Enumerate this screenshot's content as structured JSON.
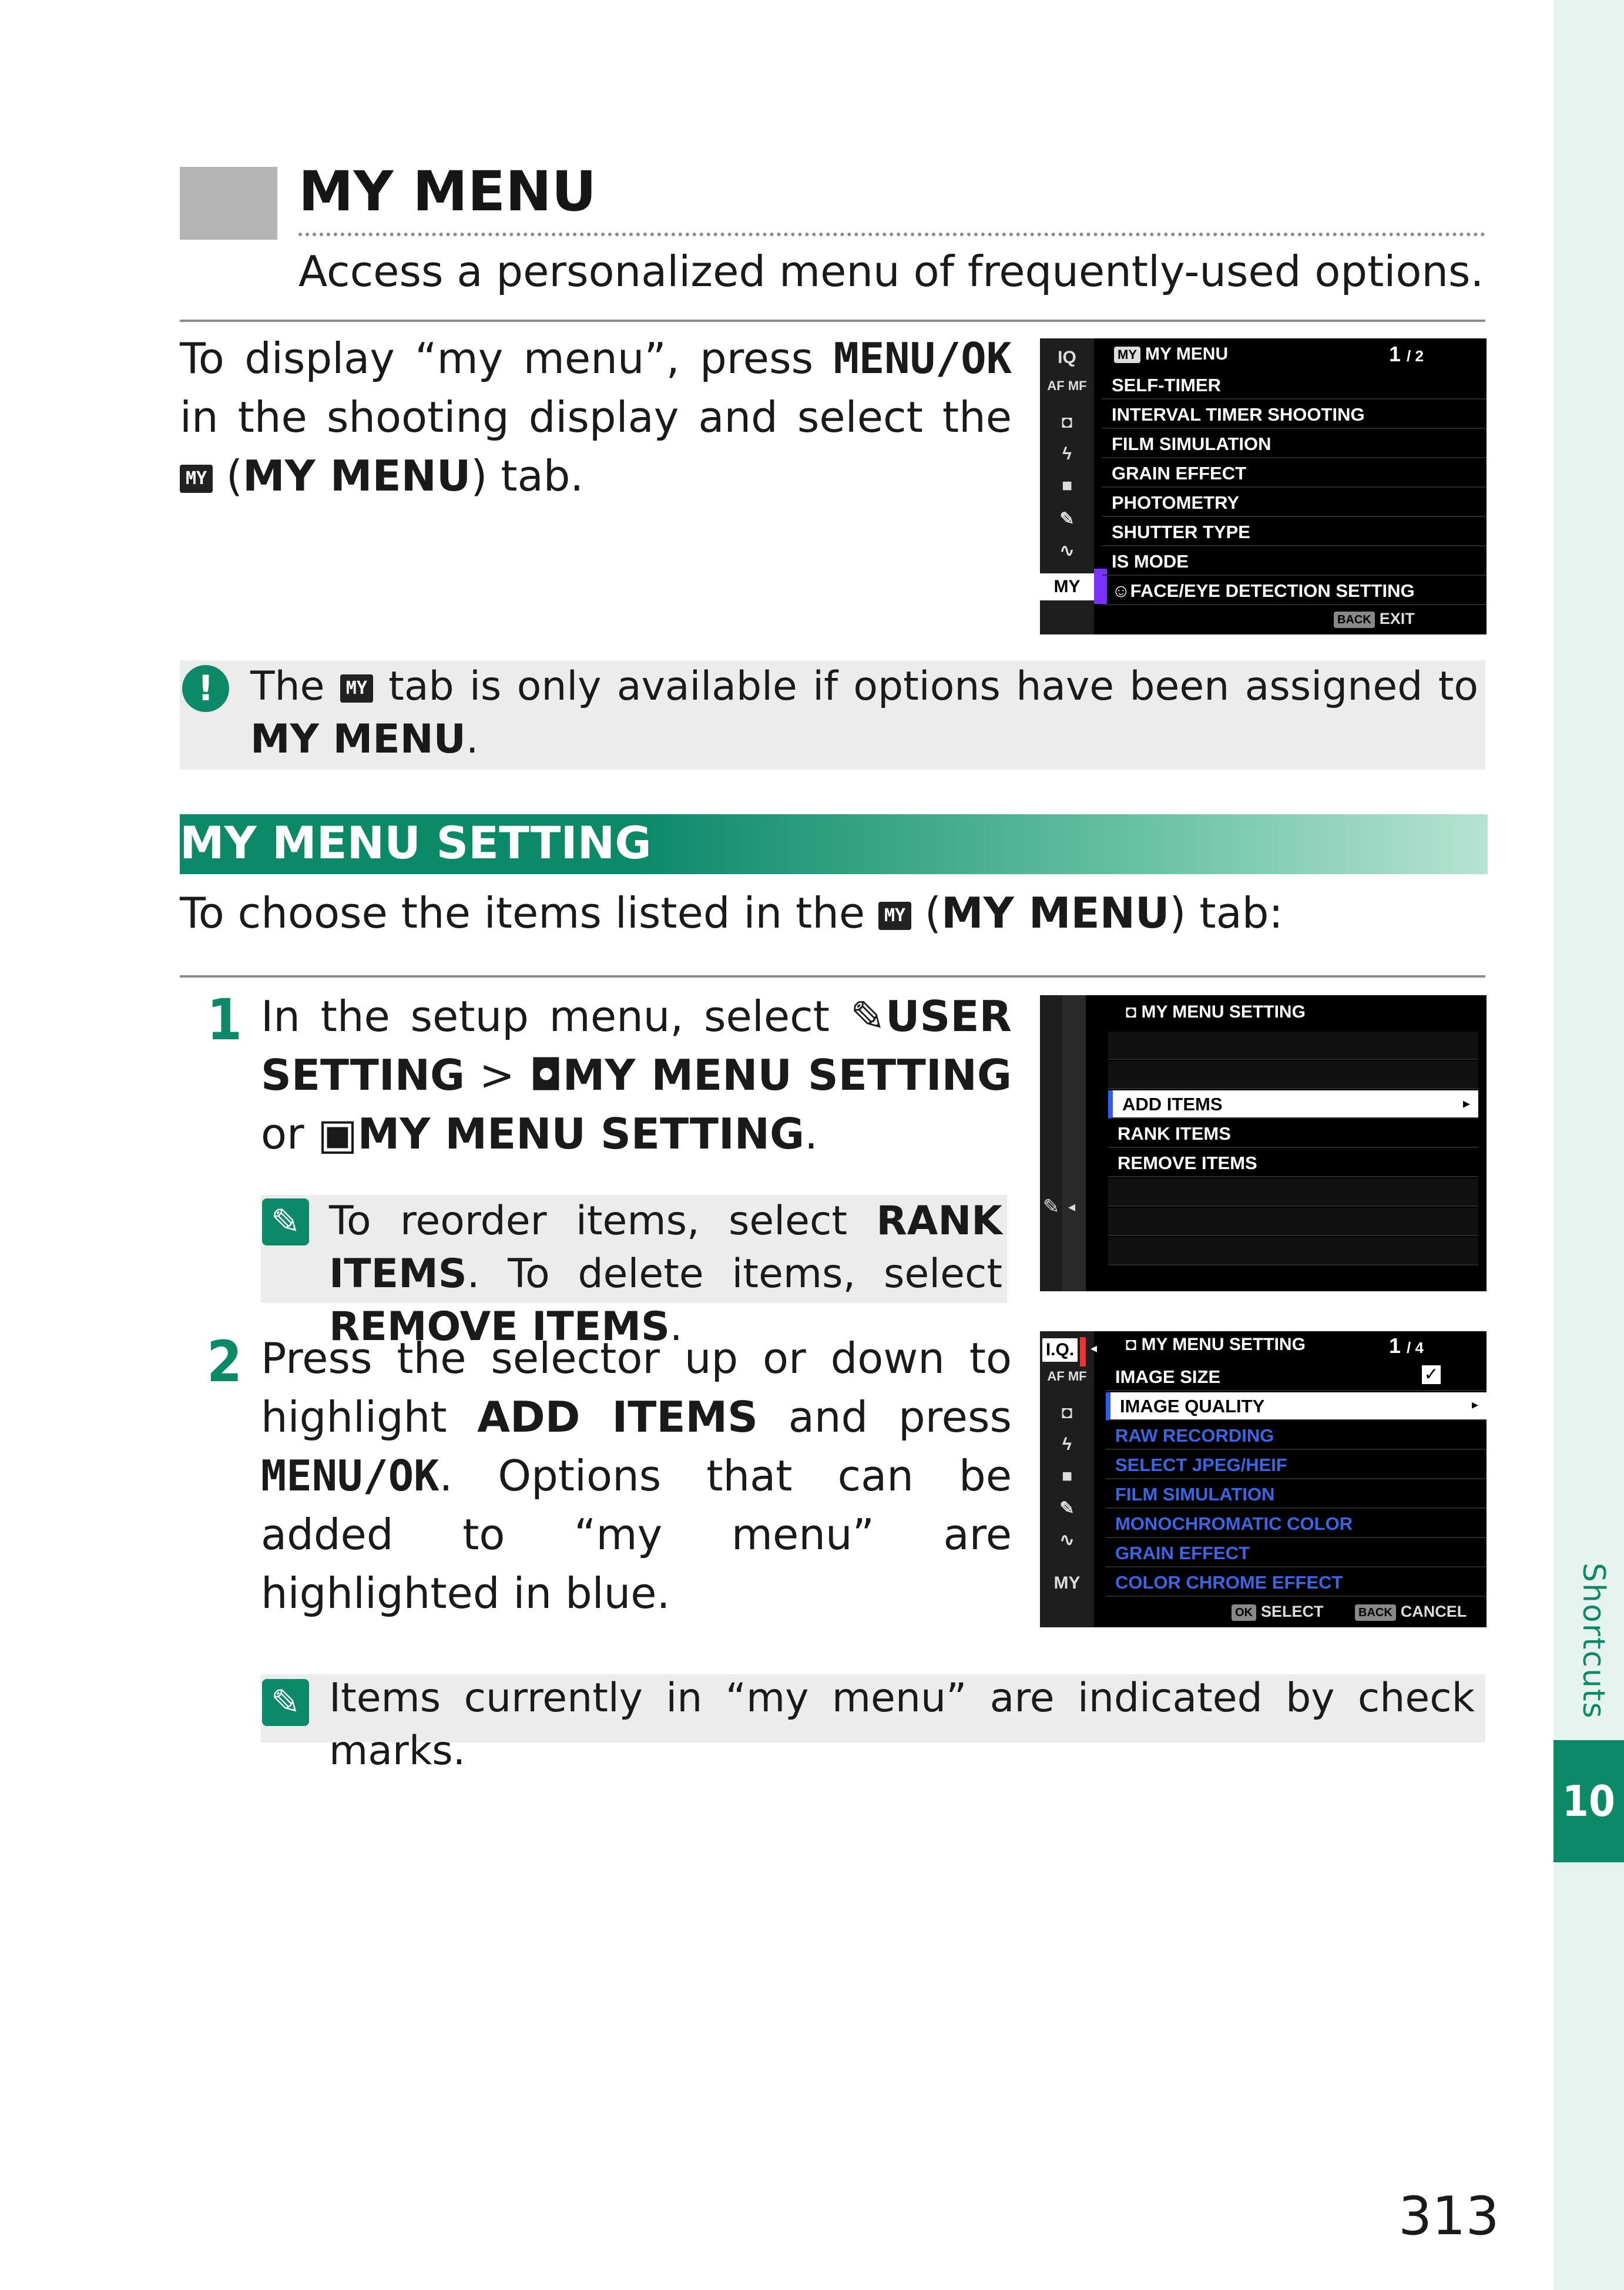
{
  "side": {
    "label": "Shortcuts",
    "chapter": "10"
  },
  "heading": {
    "title": "MY MENU",
    "subtitle": "Access a personalized menu of frequently-used options."
  },
  "intro": {
    "t1": "To display “my menu”, press ",
    "key": "MENU/OK",
    "t2": " in the shooting display and select the ",
    "icon": "MY",
    "t3": " (",
    "bold": "MY MENU",
    "t4": ") tab."
  },
  "note1": {
    "t1": "The ",
    "icon": "MY",
    "t2": " tab is only available if options have been assigned to ",
    "bold": "MY MENU",
    "t3": "."
  },
  "section": {
    "title": "MY MENU SETTING",
    "intro_t1": "To choose the items listed in the ",
    "intro_icon": "MY",
    "intro_t2": " (",
    "intro_bold": "MY MENU",
    "intro_t3": ") tab:"
  },
  "step1": {
    "num": "1",
    "t1": "In the setup menu, select ",
    "b1": "USER SETTING",
    "t2": " > ",
    "b2": "MY MENU SETTING",
    "t3": " or ",
    "b3": "MY MENU SETTING",
    "t4": ".",
    "note_t1": "To reorder items, select ",
    "note_b1": "RANK ITEMS",
    "note_t2": ". To delete items, select ",
    "note_b2": "REMOVE ITEMS",
    "note_t3": "."
  },
  "step2": {
    "num": "2",
    "t1": "Press the selector up or down to highlight ",
    "b1": "ADD ITEMS",
    "t2": " and press ",
    "key": "MENU/OK",
    "t3": ". Options that can be added to “my menu” are highlighted in blue.",
    "note": "Items currently in “my menu” are indicated by check marks."
  },
  "screen1": {
    "title": "MY MENU",
    "page": "1",
    "page_total": "/ 2",
    "side_icons": [
      "IQ",
      "AF MF",
      "camera-icon",
      "flash-icon",
      "movie-icon",
      "wrench-icon",
      "wave-icon",
      "MY"
    ],
    "items": [
      "SELF-TIMER",
      "INTERVAL TIMER SHOOTING",
      "FILM SIMULATION",
      "GRAIN EFFECT",
      "PHOTOMETRY",
      "SHUTTER TYPE",
      "IS MODE",
      "FACE/EYE DETECTION SETTING"
    ],
    "footer_key": "BACK",
    "footer_label": "EXIT"
  },
  "screen2": {
    "title": "MY MENU SETTING",
    "items": [
      "ADD ITEMS",
      "RANK ITEMS",
      "REMOVE ITEMS"
    ]
  },
  "screen3": {
    "title": "MY MENU SETTING",
    "page": "1",
    "page_total": "/ 4",
    "side_icons": [
      "I.Q.",
      "AF MF",
      "camera-icon",
      "flash-icon",
      "movie-icon",
      "wrench-icon",
      "wave-icon",
      "MY"
    ],
    "items": [
      {
        "label": "IMAGE SIZE",
        "style": "white",
        "checked": true
      },
      {
        "label": "IMAGE QUALITY",
        "style": "selected",
        "checked": false
      },
      {
        "label": "RAW RECORDING",
        "style": "blue",
        "checked": false
      },
      {
        "label": "SELECT JPEG/HEIF",
        "style": "blue",
        "checked": false
      },
      {
        "label": "FILM SIMULATION",
        "style": "blue",
        "checked": false
      },
      {
        "label": "MONOCHROMATIC COLOR",
        "style": "blue",
        "checked": false
      },
      {
        "label": "GRAIN EFFECT",
        "style": "blue",
        "checked": false
      },
      {
        "label": "COLOR CHROME EFFECT",
        "style": "blue",
        "checked": false
      }
    ],
    "footer_ok": "OK",
    "footer_select": "SELECT",
    "footer_back": "BACK",
    "footer_cancel": "CANCEL"
  },
  "page_number": "313",
  "colors": {
    "accent": "#0c8a68",
    "menu_blue": "#3a66e6"
  }
}
